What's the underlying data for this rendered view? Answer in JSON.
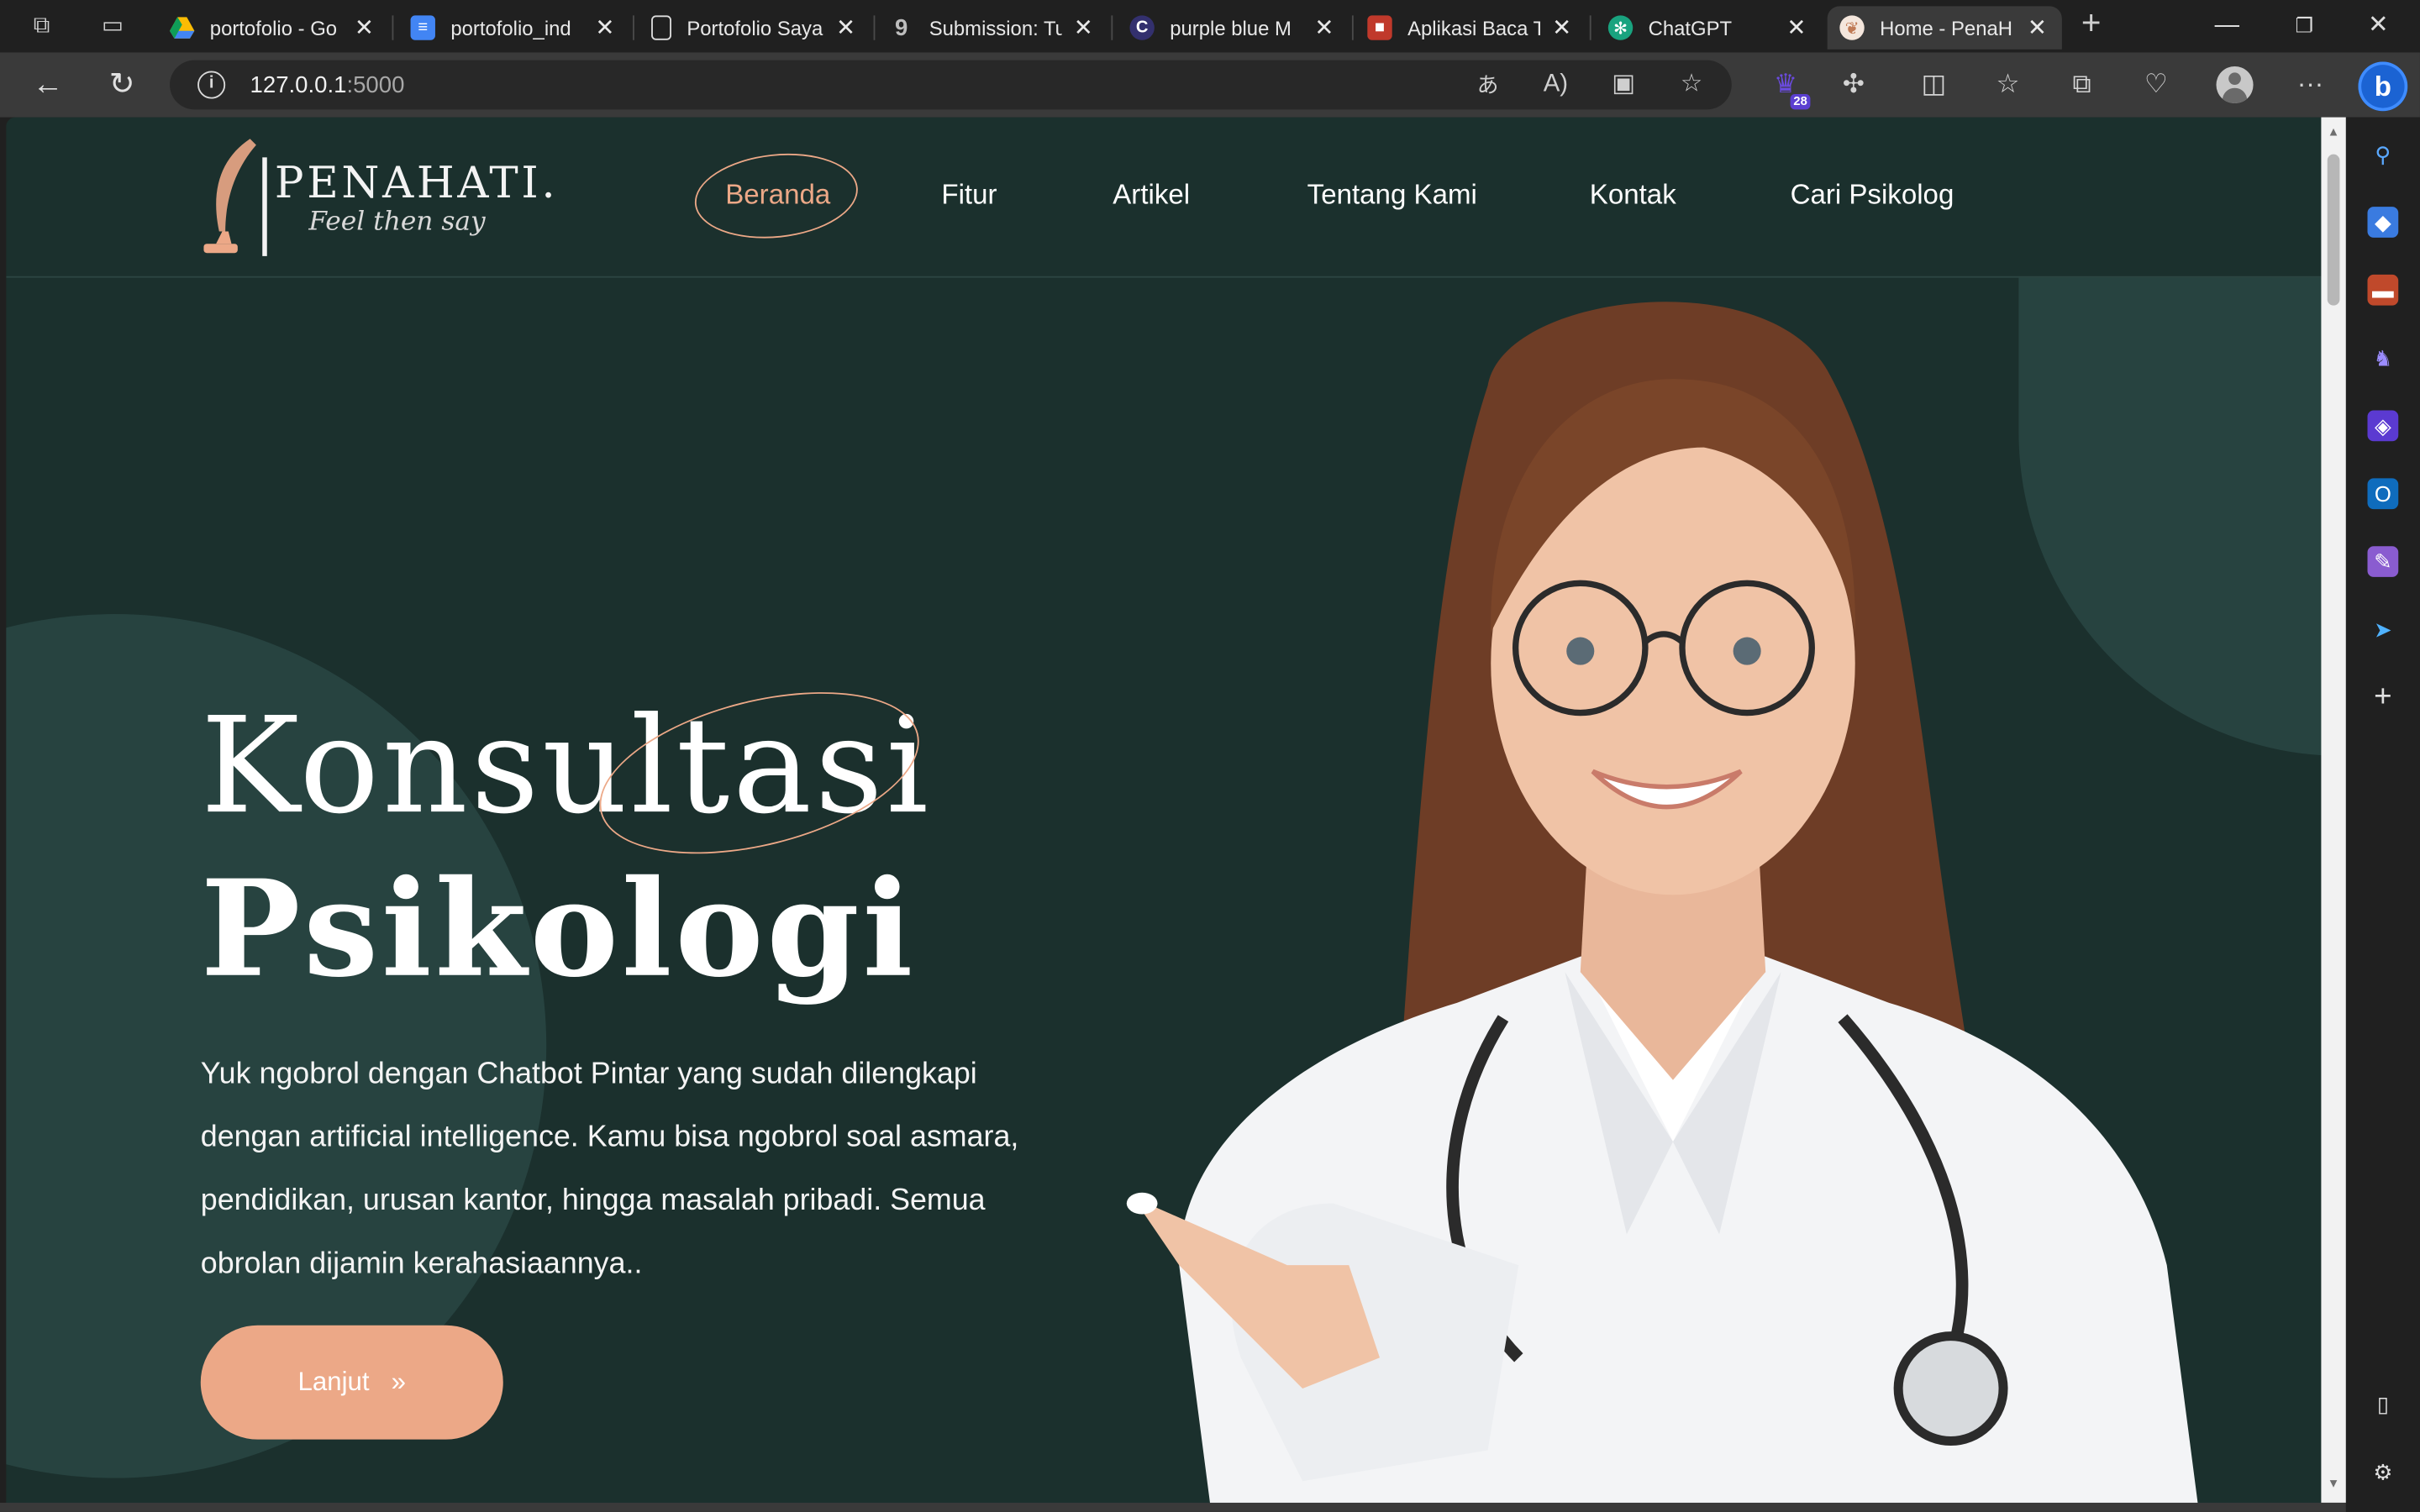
{
  "browser": {
    "tabs": [
      {
        "title": "portofolio - Go",
        "favicon": "google-drive-icon",
        "color": "#2a2a2a"
      },
      {
        "title": "portofolio_ind",
        "favicon": "google-docs-icon",
        "color": "#4285f4"
      },
      {
        "title": "Portofolio Saya",
        "favicon": "document-icon",
        "color": "#2a2a2a"
      },
      {
        "title": "Submission: Tu",
        "favicon": "dicoding-icon",
        "color": "#2a2a2a"
      },
      {
        "title": "purple blue M",
        "favicon": "canva-icon",
        "color": "#33306e"
      },
      {
        "title": "Aplikasi Baca T",
        "favicon": "app-icon",
        "color": "#c0392b"
      },
      {
        "title": "ChatGPT",
        "favicon": "chatgpt-icon",
        "color": "#19a37f"
      },
      {
        "title": "Home - PenaH",
        "favicon": "feather-icon",
        "color": "#eca887"
      }
    ],
    "url_host": "127.0.0.1",
    "url_port": ":5000",
    "extension_badge": "28"
  },
  "site": {
    "logo": {
      "name": "PENAHATI.",
      "tagline": "Feel then say"
    },
    "menu": [
      "Beranda",
      "Fitur",
      "Artikel",
      "Tentang Kami",
      "Kontak",
      "Cari Psikolog"
    ],
    "hero": {
      "title_line1": "Konsultasi",
      "title_line2": "Psikologi",
      "description": "Yuk ngobrol dengan Chatbot Pintar yang sudah dilengkapi dengan artificial intelligence. Kamu bisa ngobrol soal asmara, pendidikan, urusan kantor, hingga masalah pribadi. Semua obrolan dijamin kerahasiaannya..",
      "cta_label": "Lanjut",
      "cta_icon": "»"
    }
  },
  "colors": {
    "page_bg": "#1b302d",
    "accent": "#eca887",
    "deco": "#274340"
  }
}
